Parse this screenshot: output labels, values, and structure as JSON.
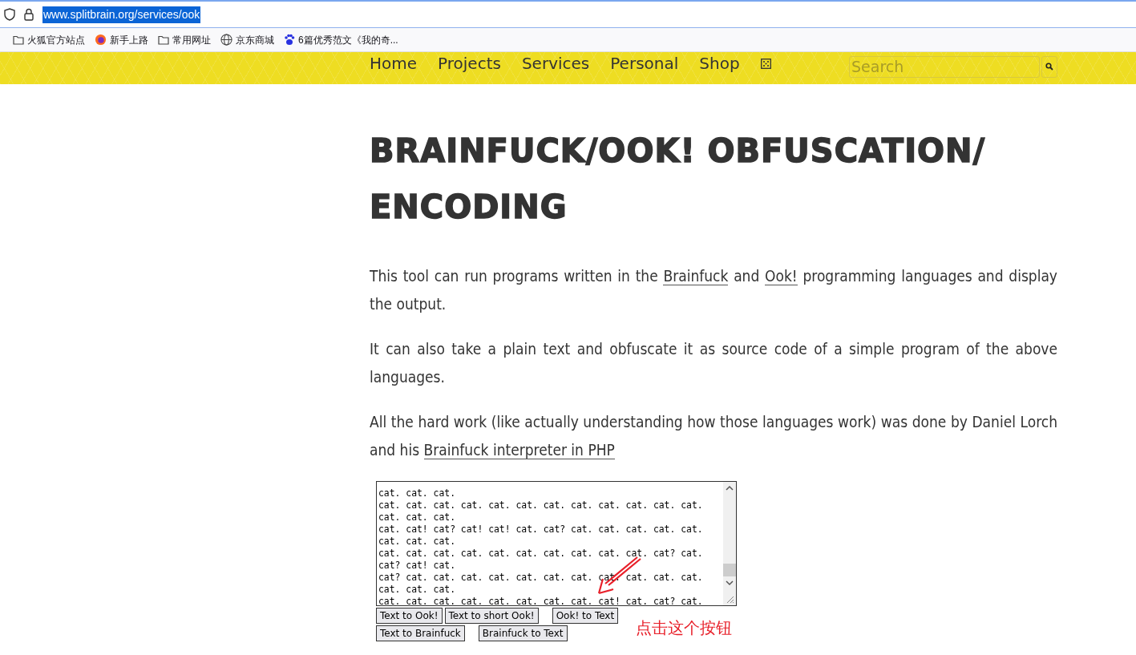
{
  "browser": {
    "url": "www.splitbrain.org/services/ook",
    "bookmarks": [
      {
        "kind": "folder",
        "label": "火狐官方站点"
      },
      {
        "kind": "firefox",
        "label": "新手上路"
      },
      {
        "kind": "folder",
        "label": "常用网址"
      },
      {
        "kind": "globe",
        "label": "京东商城"
      },
      {
        "kind": "paw",
        "label": "6篇优秀范文《我的奇..."
      }
    ]
  },
  "nav": {
    "items": [
      "Home",
      "Projects",
      "Services",
      "Personal",
      "Shop"
    ],
    "search": {
      "placeholder": "Search"
    }
  },
  "page": {
    "title": "BRAINFUCK/OOK! OBFUSCATION/ ENCODING",
    "paragraphs": [
      [
        {
          "text": "This tool can run programs written in the "
        },
        {
          "text": "Brainfuck",
          "link": true
        },
        {
          "text": " and "
        },
        {
          "text": "Ook!",
          "link": true
        },
        {
          "text": " programming languages and display the output."
        }
      ],
      [
        {
          "text": "It can also take a plain text and obfuscate it as source code of a simple program of the above languages."
        }
      ],
      [
        {
          "text": "All the hard work (like actually understanding how those languages work) was done by Daniel Lorch and his "
        },
        {
          "text": "Brainfuck interpreter in PHP",
          "link": true
        }
      ]
    ],
    "code_lines": [
      "cat. cat. cat.",
      "cat. cat. cat. cat. cat. cat. cat. cat. cat. cat. cat. cat.",
      "cat. cat. cat.",
      "cat. cat! cat? cat! cat! cat. cat? cat. cat. cat. cat. cat.",
      "cat. cat. cat.",
      "cat. cat. cat. cat. cat. cat. cat. cat. cat. cat. cat? cat.",
      "cat? cat! cat.",
      "cat? cat. cat. cat. cat. cat. cat. cat. cat. cat. cat. cat.",
      "cat. cat. cat.",
      "cat. cat. cat. cat. cat. cat. cat. cat. cat! cat. cat? cat."
    ],
    "button_rows": [
      [
        "Text to Ook!",
        "Text to short Ook!",
        "Ook! to Text"
      ],
      [
        "Text to Brainfuck",
        "Brainfuck to Text"
      ]
    ],
    "annotation": "点击这个按钮"
  }
}
